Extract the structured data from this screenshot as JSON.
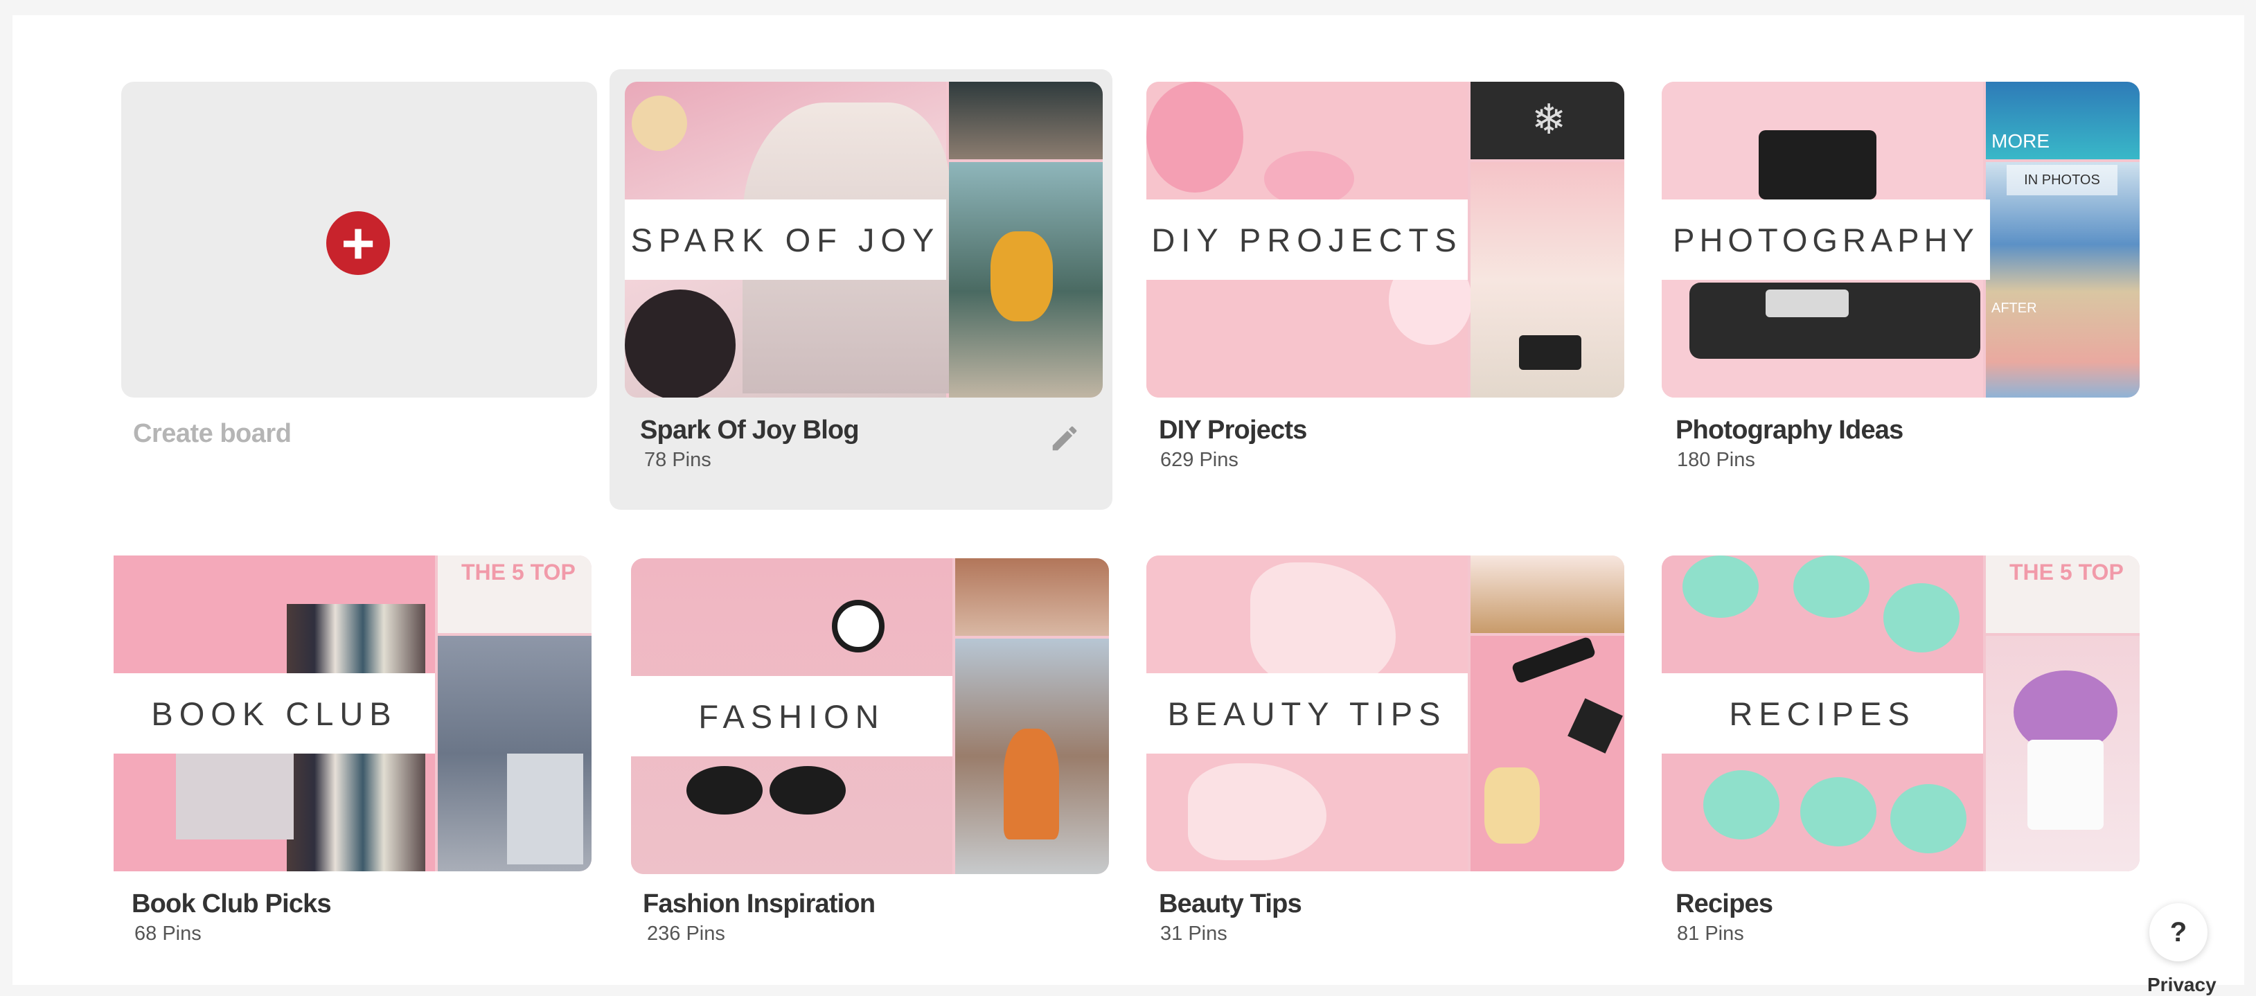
{
  "create_board": {
    "label": "Create board",
    "icon": "plus-icon"
  },
  "boards": [
    {
      "name": "Spark Of Joy Blog",
      "pins": "78 Pins",
      "cover_text": "SPARK OF JOY"
    },
    {
      "name": "DIY Projects",
      "pins": "629 Pins",
      "cover_text": "DIY PROJECTS"
    },
    {
      "name": "Photography Ideas",
      "pins": "180 Pins",
      "cover_text": "PHOTOGRAPHY",
      "side_texts": [
        "MORE",
        "IN PHOTOS",
        "AFTER"
      ]
    },
    {
      "name": "Book Club Picks",
      "pins": "68 Pins",
      "cover_text": "BOOK CLUB",
      "side_texts": [
        "THE 5 TOP"
      ]
    },
    {
      "name": "Fashion Inspiration",
      "pins": "236 Pins",
      "cover_text": "FASHION"
    },
    {
      "name": "Beauty Tips",
      "pins": "31 Pins",
      "cover_text": "BEAUTY TIPS"
    },
    {
      "name": "Recipes",
      "pins": "81 Pins",
      "cover_text": "RECIPES",
      "side_texts": [
        "THE 5 TOP"
      ]
    }
  ],
  "help": {
    "label": "?"
  },
  "footer": {
    "privacy": "Privacy"
  },
  "colors": {
    "accent": "#c8232c",
    "cover_pink": "#f4c6cf",
    "card_bg": "#ececec"
  }
}
